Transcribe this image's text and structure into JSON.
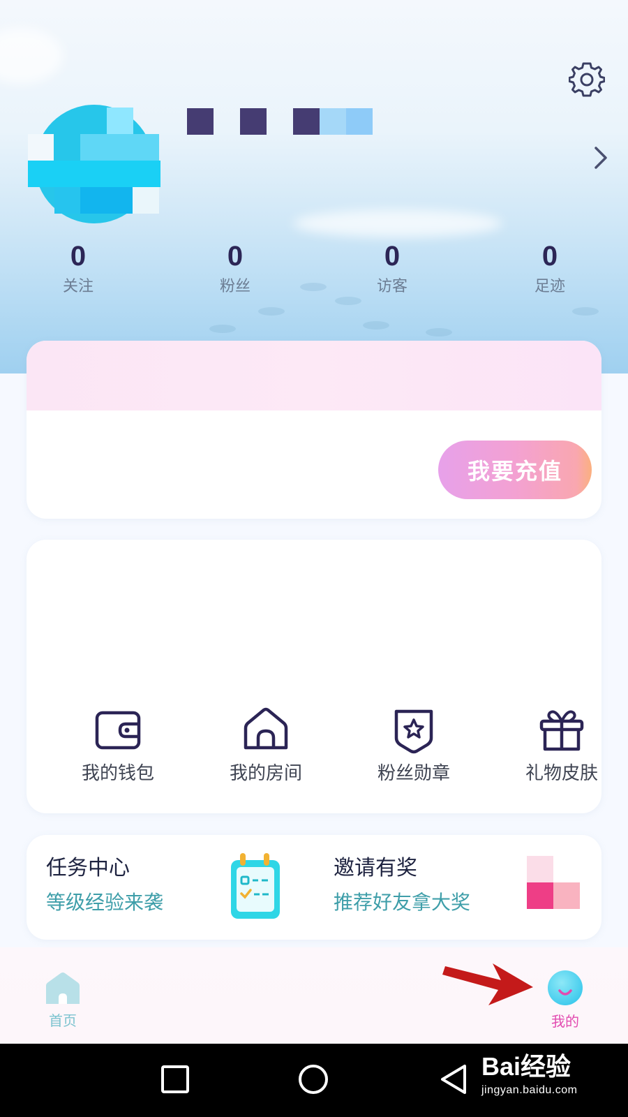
{
  "stats": [
    {
      "value": "0",
      "label": "关注"
    },
    {
      "value": "0",
      "label": "粉丝"
    },
    {
      "value": "0",
      "label": "访客"
    },
    {
      "value": "0",
      "label": "足迹"
    }
  ],
  "recharge": {
    "button_label": "我要充值"
  },
  "menu": [
    {
      "label": "我的钱包",
      "icon": "wallet-icon"
    },
    {
      "label": "我的房间",
      "icon": "house-icon"
    },
    {
      "label": "粉丝勋章",
      "icon": "badge-star-icon"
    },
    {
      "label": "礼物皮肤",
      "icon": "gift-icon"
    }
  ],
  "promo": {
    "task": {
      "title": "任务中心",
      "subtitle": "等级经验来袭",
      "icon": "task-calendar-icon"
    },
    "invite": {
      "title": "邀请有奖",
      "subtitle": "推荐好友拿大奖"
    }
  },
  "tabbar": {
    "home_label": "首页",
    "mine_label": "我的",
    "active_tab": "mine"
  },
  "watermark": {
    "logo": "Bai经验",
    "url": "jingyan.baidu.com"
  },
  "colors": {
    "accent_pink": "#e24bb0",
    "teal_text": "#3e9ea9",
    "dark_navy": "#2c2656",
    "arrow_red": "#c41a1a"
  }
}
